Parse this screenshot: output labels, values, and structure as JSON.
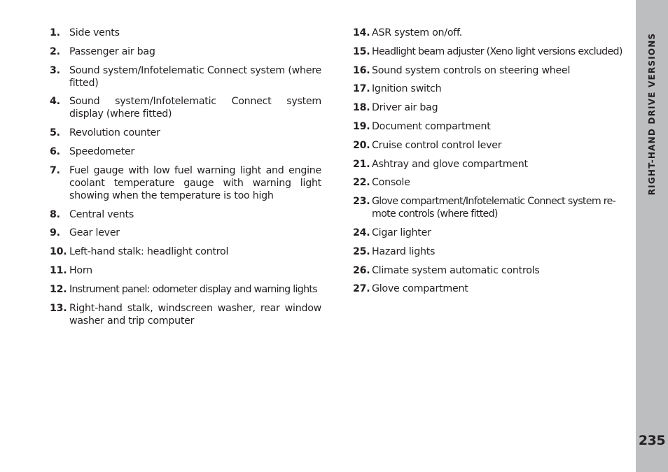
{
  "left_items": [
    {
      "num": "1.",
      "text": "Side vents"
    },
    {
      "num": "2.",
      "text": "Passenger air bag"
    },
    {
      "num": "3.",
      "text": "Sound system/Infotelematic Connect system (where fitted)"
    },
    {
      "num": "4.",
      "text": "Sound system/Infotelematic Connect system display (where fitted)"
    },
    {
      "num": "5.",
      "text": "Revolution counter"
    },
    {
      "num": "6.",
      "text": "Speedometer"
    },
    {
      "num": "7.",
      "text": "Fuel gauge with low fuel warning light and engine coolant temperature gauge with warning light showing when the temperature is too high"
    },
    {
      "num": "8.",
      "text": "Central vents"
    },
    {
      "num": "9.",
      "text": "Gear lever"
    },
    {
      "num": "10.",
      "text": "Left-hand stalk: headlight control"
    },
    {
      "num": "11.",
      "text": "Horn"
    },
    {
      "num": "12.",
      "text": "Instrument panel: odometer display and warning lights"
    },
    {
      "num": "13.",
      "text": "Right-hand stalk, windscreen washer, rear window washer and trip computer"
    }
  ],
  "right_items": [
    {
      "num": "14.",
      "text": "ASR system on/off."
    },
    {
      "num": "15.",
      "text": "Headlight beam adjuster (Xeno light versions excluded)"
    },
    {
      "num": "16.",
      "text": "Sound system controls on steering wheel"
    },
    {
      "num": "17.",
      "text": "Ignition switch"
    },
    {
      "num": "18.",
      "text": "Driver air bag"
    },
    {
      "num": "19.",
      "text": "Document compartment"
    },
    {
      "num": "20.",
      "text": "Cruise control control lever"
    },
    {
      "num": "21.",
      "text": "Ashtray and glove compartment"
    },
    {
      "num": "22.",
      "text": "Console"
    },
    {
      "num": "23.",
      "text": "Glove compartment/Infotelematic Connect system re-mote controls (where fitted)"
    },
    {
      "num": "24.",
      "text": "Cigar lighter"
    },
    {
      "num": "25.",
      "text": "Hazard lights"
    },
    {
      "num": "26.",
      "text": "Climate system automatic controls"
    },
    {
      "num": "27.",
      "text": "Glove compartment"
    }
  ],
  "sidebar": {
    "section_label": "RIGHT-HAND DRIVE VERSIONS",
    "page_number": "235"
  },
  "colors": {
    "text": "#231f20",
    "sidebar_bg": "#bdbec0",
    "page_bg": "#ffffff"
  }
}
